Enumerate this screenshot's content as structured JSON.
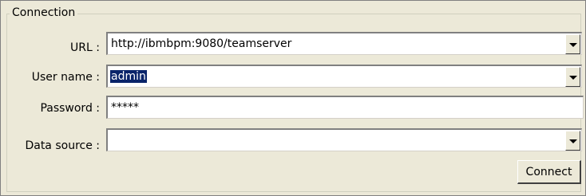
{
  "connection": {
    "legend": "Connection",
    "url": {
      "label": "URL :",
      "value": "http://ibmbpm:9080/teamserver"
    },
    "username": {
      "label": "User name :",
      "value": "admin"
    },
    "password": {
      "label": "Password :",
      "value": "*****"
    },
    "datasource": {
      "label": "Data source :",
      "value": ""
    },
    "connect_label": "Connect"
  }
}
